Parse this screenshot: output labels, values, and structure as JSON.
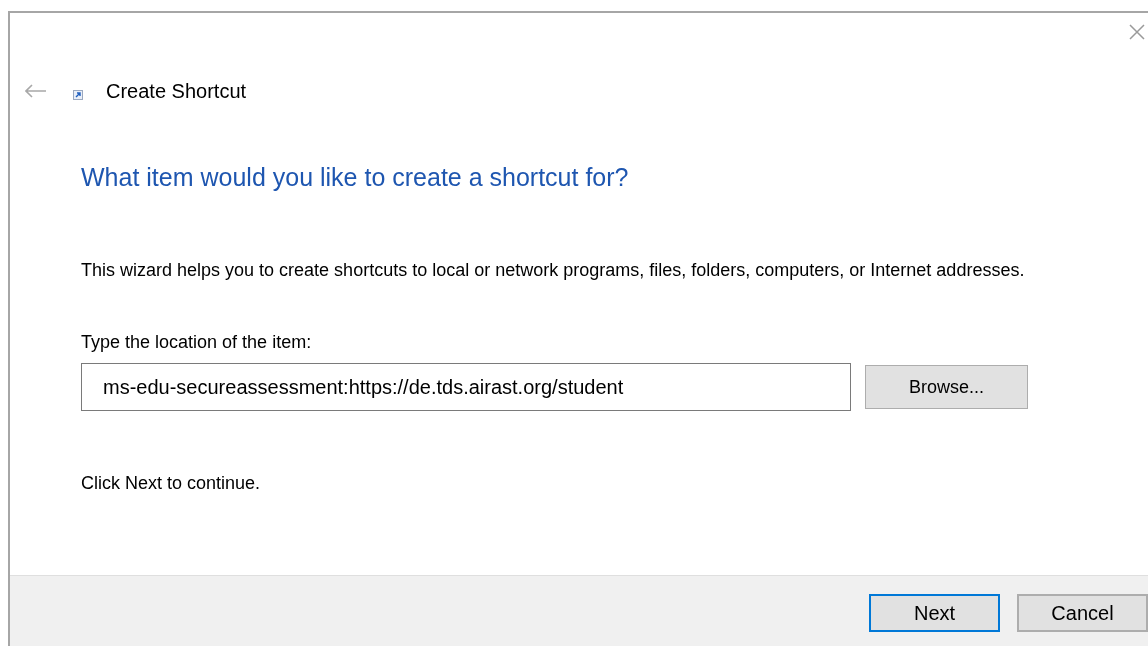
{
  "window": {
    "title": "Create Shortcut"
  },
  "heading": "What item would you like to create a shortcut for?",
  "description": "This wizard helps you to create shortcuts to local or network programs, files, folders, computers, or Internet addresses.",
  "location": {
    "label": "Type the location of the item:",
    "value": "ms-edu-secureassessment:https://de.tds.airast.org/student",
    "browse_button": "Browse..."
  },
  "hint": "Click Next to continue.",
  "buttons": [
    {
      "label": "Next",
      "selected": true
    },
    {
      "label": "Cancel",
      "selected": false
    }
  ]
}
